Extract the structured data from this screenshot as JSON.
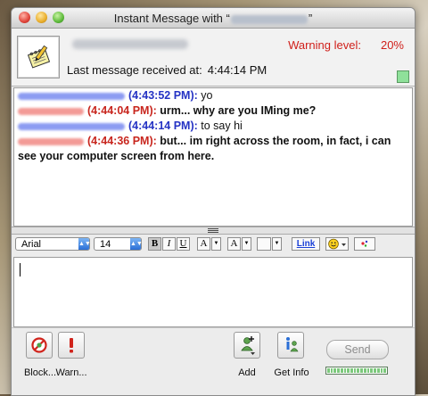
{
  "window": {
    "title_prefix": "Instant Message with “",
    "title_suffix": "”"
  },
  "header": {
    "warning_label": "Warning level:",
    "warning_value": "20%",
    "last_message_label": "Last message received at:",
    "last_message_time": "4:44:14 PM"
  },
  "transcript": [
    {
      "timestamp": "(4:43:52 PM):",
      "text": " yo",
      "sender": "buddy"
    },
    {
      "timestamp": "(4:44:04 PM):",
      "text": " urm... why are you IMing me?",
      "sender": "self"
    },
    {
      "timestamp": "(4:44:14 PM):",
      "text": " to say hi",
      "sender": "buddy"
    },
    {
      "timestamp": "(4:44:36 PM):",
      "text": " but... im right across the room, in fact, i can see your computer screen from here.",
      "sender": "self"
    }
  ],
  "toolbar": {
    "font": "Arial",
    "size": "14",
    "bold": "B",
    "italic": "I",
    "underline": "U",
    "text_color": "A",
    "background_color": "A",
    "link": "Link"
  },
  "compose": {
    "value": ""
  },
  "actions": {
    "block": "Block...",
    "warn": "Warn...",
    "add": "Add",
    "get_info": "Get Info",
    "send": "Send"
  },
  "colors": {
    "buddy_timestamp": "#2533c4",
    "self_timestamp": "#c8261e",
    "warning": "#d0201b",
    "status_indicator": "#8fe19a"
  },
  "icons": {
    "buddy_icon": "notepad-pencil-icon",
    "block": "no-entry-icon",
    "warn": "exclamation-icon",
    "add": "add-buddy-icon",
    "get_info": "info-icon",
    "emoticon": "smiley-icon"
  }
}
